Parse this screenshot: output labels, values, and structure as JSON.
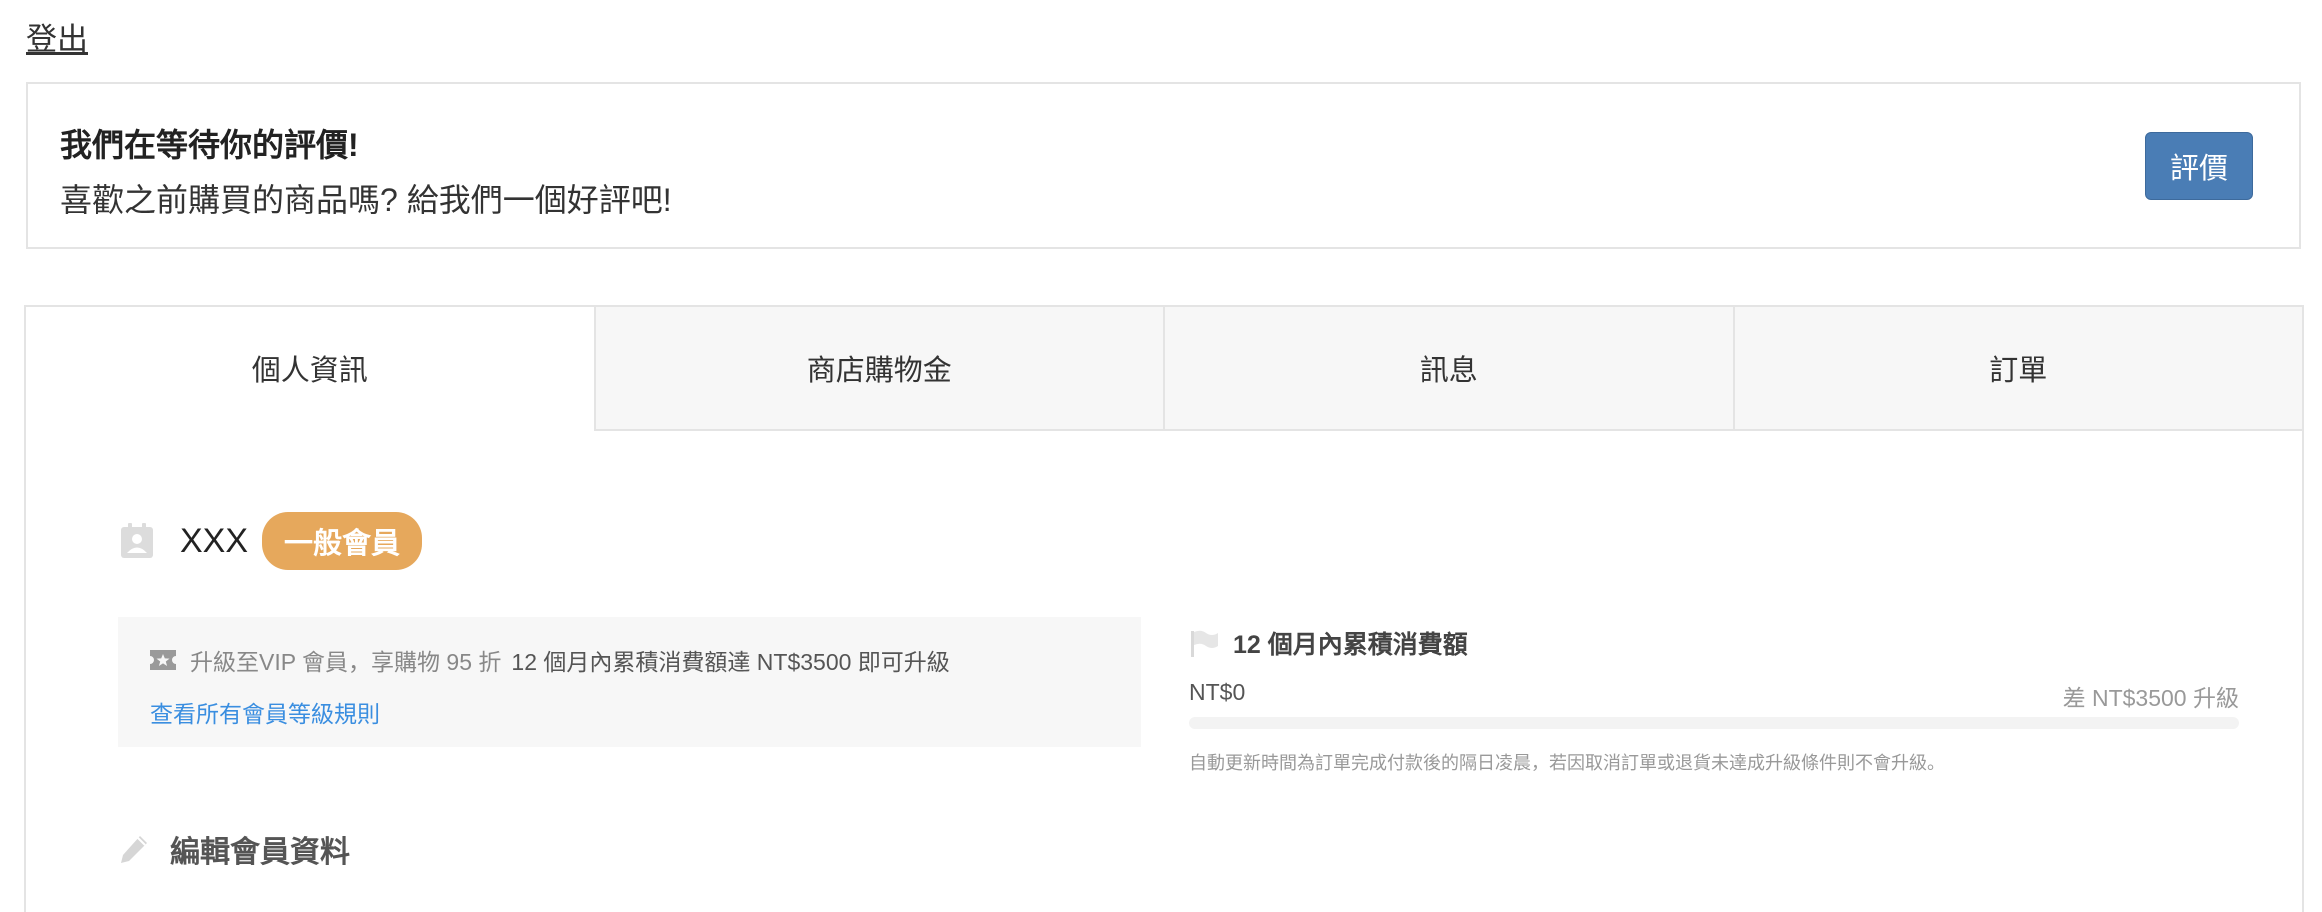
{
  "header": {
    "logout_label": "登出"
  },
  "review_prompt": {
    "title": "我們在等待你的評價!",
    "subtitle": "喜歡之前購買的商品嗎? 給我們一個好評吧!",
    "button_label": "評價",
    "button_color": "#4a7db5"
  },
  "tabs": [
    {
      "label": "個人資訊",
      "active": true
    },
    {
      "label": "商店購物金",
      "active": false
    },
    {
      "label": "訊息",
      "active": false
    },
    {
      "label": "訂單",
      "active": false
    }
  ],
  "profile": {
    "name": "XXX",
    "tier_badge": "一般會員",
    "badge_color": "#e6a85c",
    "icon": "id-card-icon"
  },
  "upgrade": {
    "icon": "ticket-icon",
    "text": "升級至VIP 會員，享購物 95 折",
    "requirement": "12 個月內累積消費額達 NT$3500 即可升級",
    "link_label": "查看所有會員等級規則"
  },
  "spend": {
    "icon": "flag-icon",
    "heading": "12 個月內累積消費額",
    "current": "NT$0",
    "remaining": "差 NT$3500 升級",
    "progress": 0,
    "note": "自動更新時間為訂單完成付款後的隔日凌晨，若因取消訂單或退貨未達成升級條件則不會升級。"
  },
  "edit_section": {
    "icon": "pencil-icon",
    "title": "編輯會員資料"
  }
}
